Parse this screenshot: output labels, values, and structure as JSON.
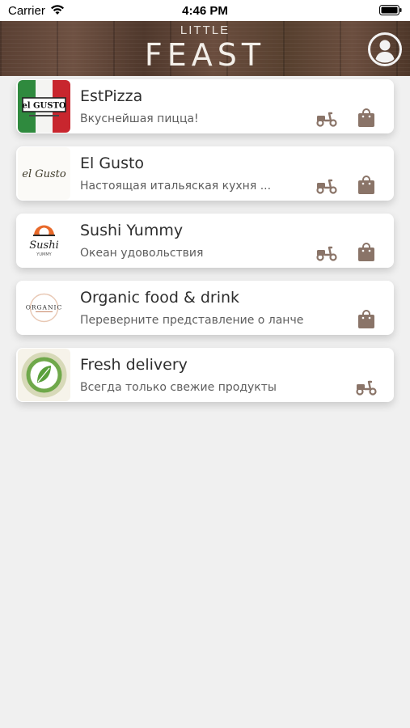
{
  "status_bar": {
    "carrier": "Carrier",
    "time": "4:46 PM"
  },
  "header": {
    "logo_small": "LITTLE",
    "logo_big": "FEAST"
  },
  "colors": {
    "icon_brown": "#8a7468",
    "header_wood": "#5e4435",
    "background": "#f0f0f0"
  },
  "restaurants": [
    {
      "name": "EstPizza",
      "description": "Вкуснейшая пицца!",
      "logo_text": "el GUSTO",
      "delivery": true,
      "takeaway": true
    },
    {
      "name": "El Gusto",
      "description": "Настоящая итальяская кухня ...",
      "logo_text": "el Gusto",
      "delivery": true,
      "takeaway": true
    },
    {
      "name": "Sushi Yummy",
      "description": "Океан удовольствия",
      "logo_text": "Sushi",
      "logo_sub": "YUMMY",
      "delivery": true,
      "takeaway": true
    },
    {
      "name": "Organic food & drink",
      "description": "Переверните представление о ланче",
      "logo_text": "ORGANIC",
      "delivery": false,
      "takeaway": true
    },
    {
      "name": "Fresh delivery",
      "description": "Всегда только свежие продукты",
      "delivery": true,
      "takeaway": false
    }
  ]
}
